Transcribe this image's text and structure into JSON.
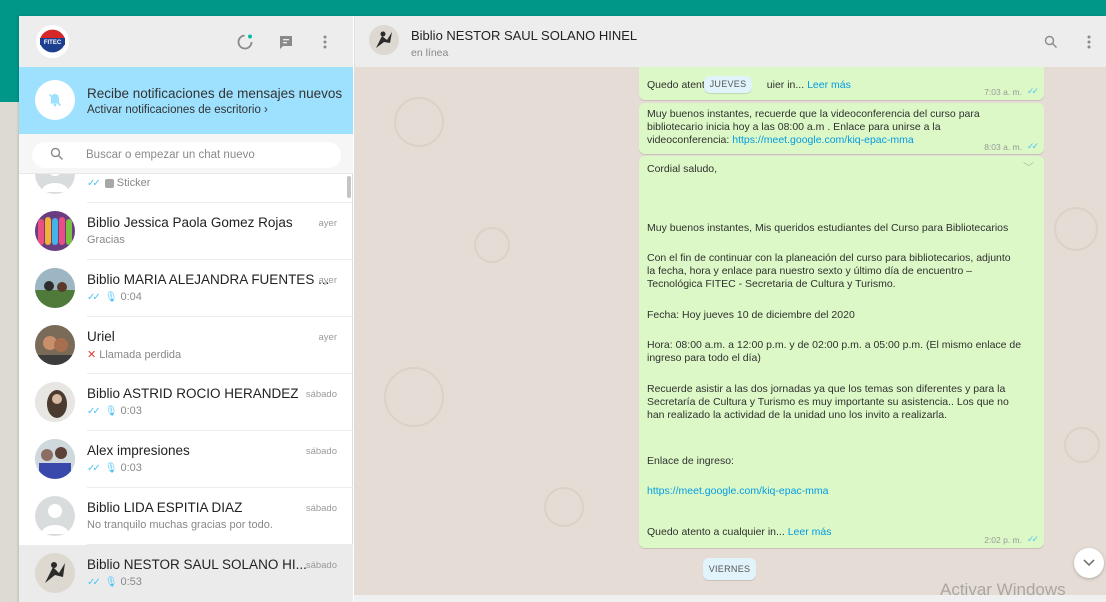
{
  "colors": {
    "brand": "#009688",
    "notification": "#9de1fe",
    "outgoing_bubble": "#dcf8c6",
    "read_tick": "#4fc3f7",
    "link": "#039be5",
    "missed_call": "#e53935"
  },
  "left_header": {
    "icons": [
      "status-icon",
      "new-chat-icon",
      "menu-icon"
    ]
  },
  "notification": {
    "title": "Recibe notificaciones de mensajes nuevos",
    "link": "Activar notificaciones de escritorio ›",
    "icon": "bell-off-icon"
  },
  "search": {
    "placeholder": "Buscar o empezar un chat nuevo"
  },
  "chats": [
    {
      "name": "",
      "sub": "Sticker",
      "time": "",
      "ticks": "✓✓",
      "kind": "sticker"
    },
    {
      "name": "Biblio Jessica Paola Gomez Rojas",
      "sub": "Gracias",
      "time": "ayer",
      "ticks": "",
      "kind": "text"
    },
    {
      "name": "Biblio MARIA ALEJANDRA FUENTES ...",
      "sub": "0:04",
      "time": "ayer",
      "ticks": "✓✓",
      "kind": "voice"
    },
    {
      "name": "Uriel",
      "sub": "Llamada perdida",
      "time": "ayer",
      "ticks": "",
      "kind": "missed"
    },
    {
      "name": "Biblio ASTRID ROCIO HERANDEZ",
      "sub": "0:03",
      "time": "sábado",
      "ticks": "✓✓",
      "kind": "voice"
    },
    {
      "name": "Alex impresiones",
      "sub": "0:03",
      "time": "sábado",
      "ticks": "✓✓",
      "kind": "voice"
    },
    {
      "name": "Biblio LIDA ESPITIA DIAZ",
      "sub": "No tranquilo muchas gracias por todo.",
      "time": "sábado",
      "ticks": "",
      "kind": "text"
    },
    {
      "name": "Biblio NESTOR SAUL SOLANO HI...",
      "sub": "0:53",
      "time": "sábado",
      "ticks": "✓✓",
      "kind": "voice"
    }
  ],
  "conversation": {
    "contact_name": "Biblio NESTOR SAUL SOLANO HINEL",
    "status": "en línea",
    "day_label_1": "JUEVES",
    "day_label_2": "VIERNES",
    "msg1": {
      "text": "Quedo atent",
      "text_end": "uier in...",
      "more": "Leer más",
      "time": "7:03 a. m."
    },
    "msg2": {
      "line1": "Muy buenos instantes, recuerde que la videoconferencia del curso para",
      "line2": "bibliotecario inicia hoy a las 08:00 a.m . Enlace para unirse a la",
      "line3": "videoconferencia:",
      "link": "https://meet.google.com/kiq-epac-mma",
      "time": "8:03 a. m."
    },
    "msg3": {
      "greeting": "Cordial saludo,",
      "p1": "Muy buenos instantes, Mis queridos estudiantes del Curso para Bibliotecarios",
      "p2a": "Con el fin de continuar con la planeación del curso para bibliotecarios, adjunto",
      "p2b": "la fecha, hora y enlace para nuestro sexto y último día de encuentro –",
      "p2c": "Tecnológica FITEC - Secretaria de Cultura y Turismo.",
      "p3": "Fecha: Hoy jueves 10 de diciembre del 2020",
      "p4a": "Hora:  08:00 a.m. a 12:00 p.m. y de 02:00 p.m. a 05:00 p.m. (El mismo enlace de",
      "p4b": "ingreso para todo el día)",
      "p5a": "Recuerde asistir a las dos jornadas ya que los temas son diferentes y para la",
      "p5b": "Secretaría de Cultura y Turismo es muy importante su asistencia.. Los que no",
      "p5c": "han realizado la actividad de la unidad uno los invito a realizarla.",
      "p6": "Enlace de ingreso:",
      "link": "https://meet.google.com/kiq-epac-mma",
      "closing": "Quedo atento a cualquier in...",
      "more": "Leer más",
      "time": "2:02 p. m."
    }
  },
  "watermark": "Activar Windows"
}
